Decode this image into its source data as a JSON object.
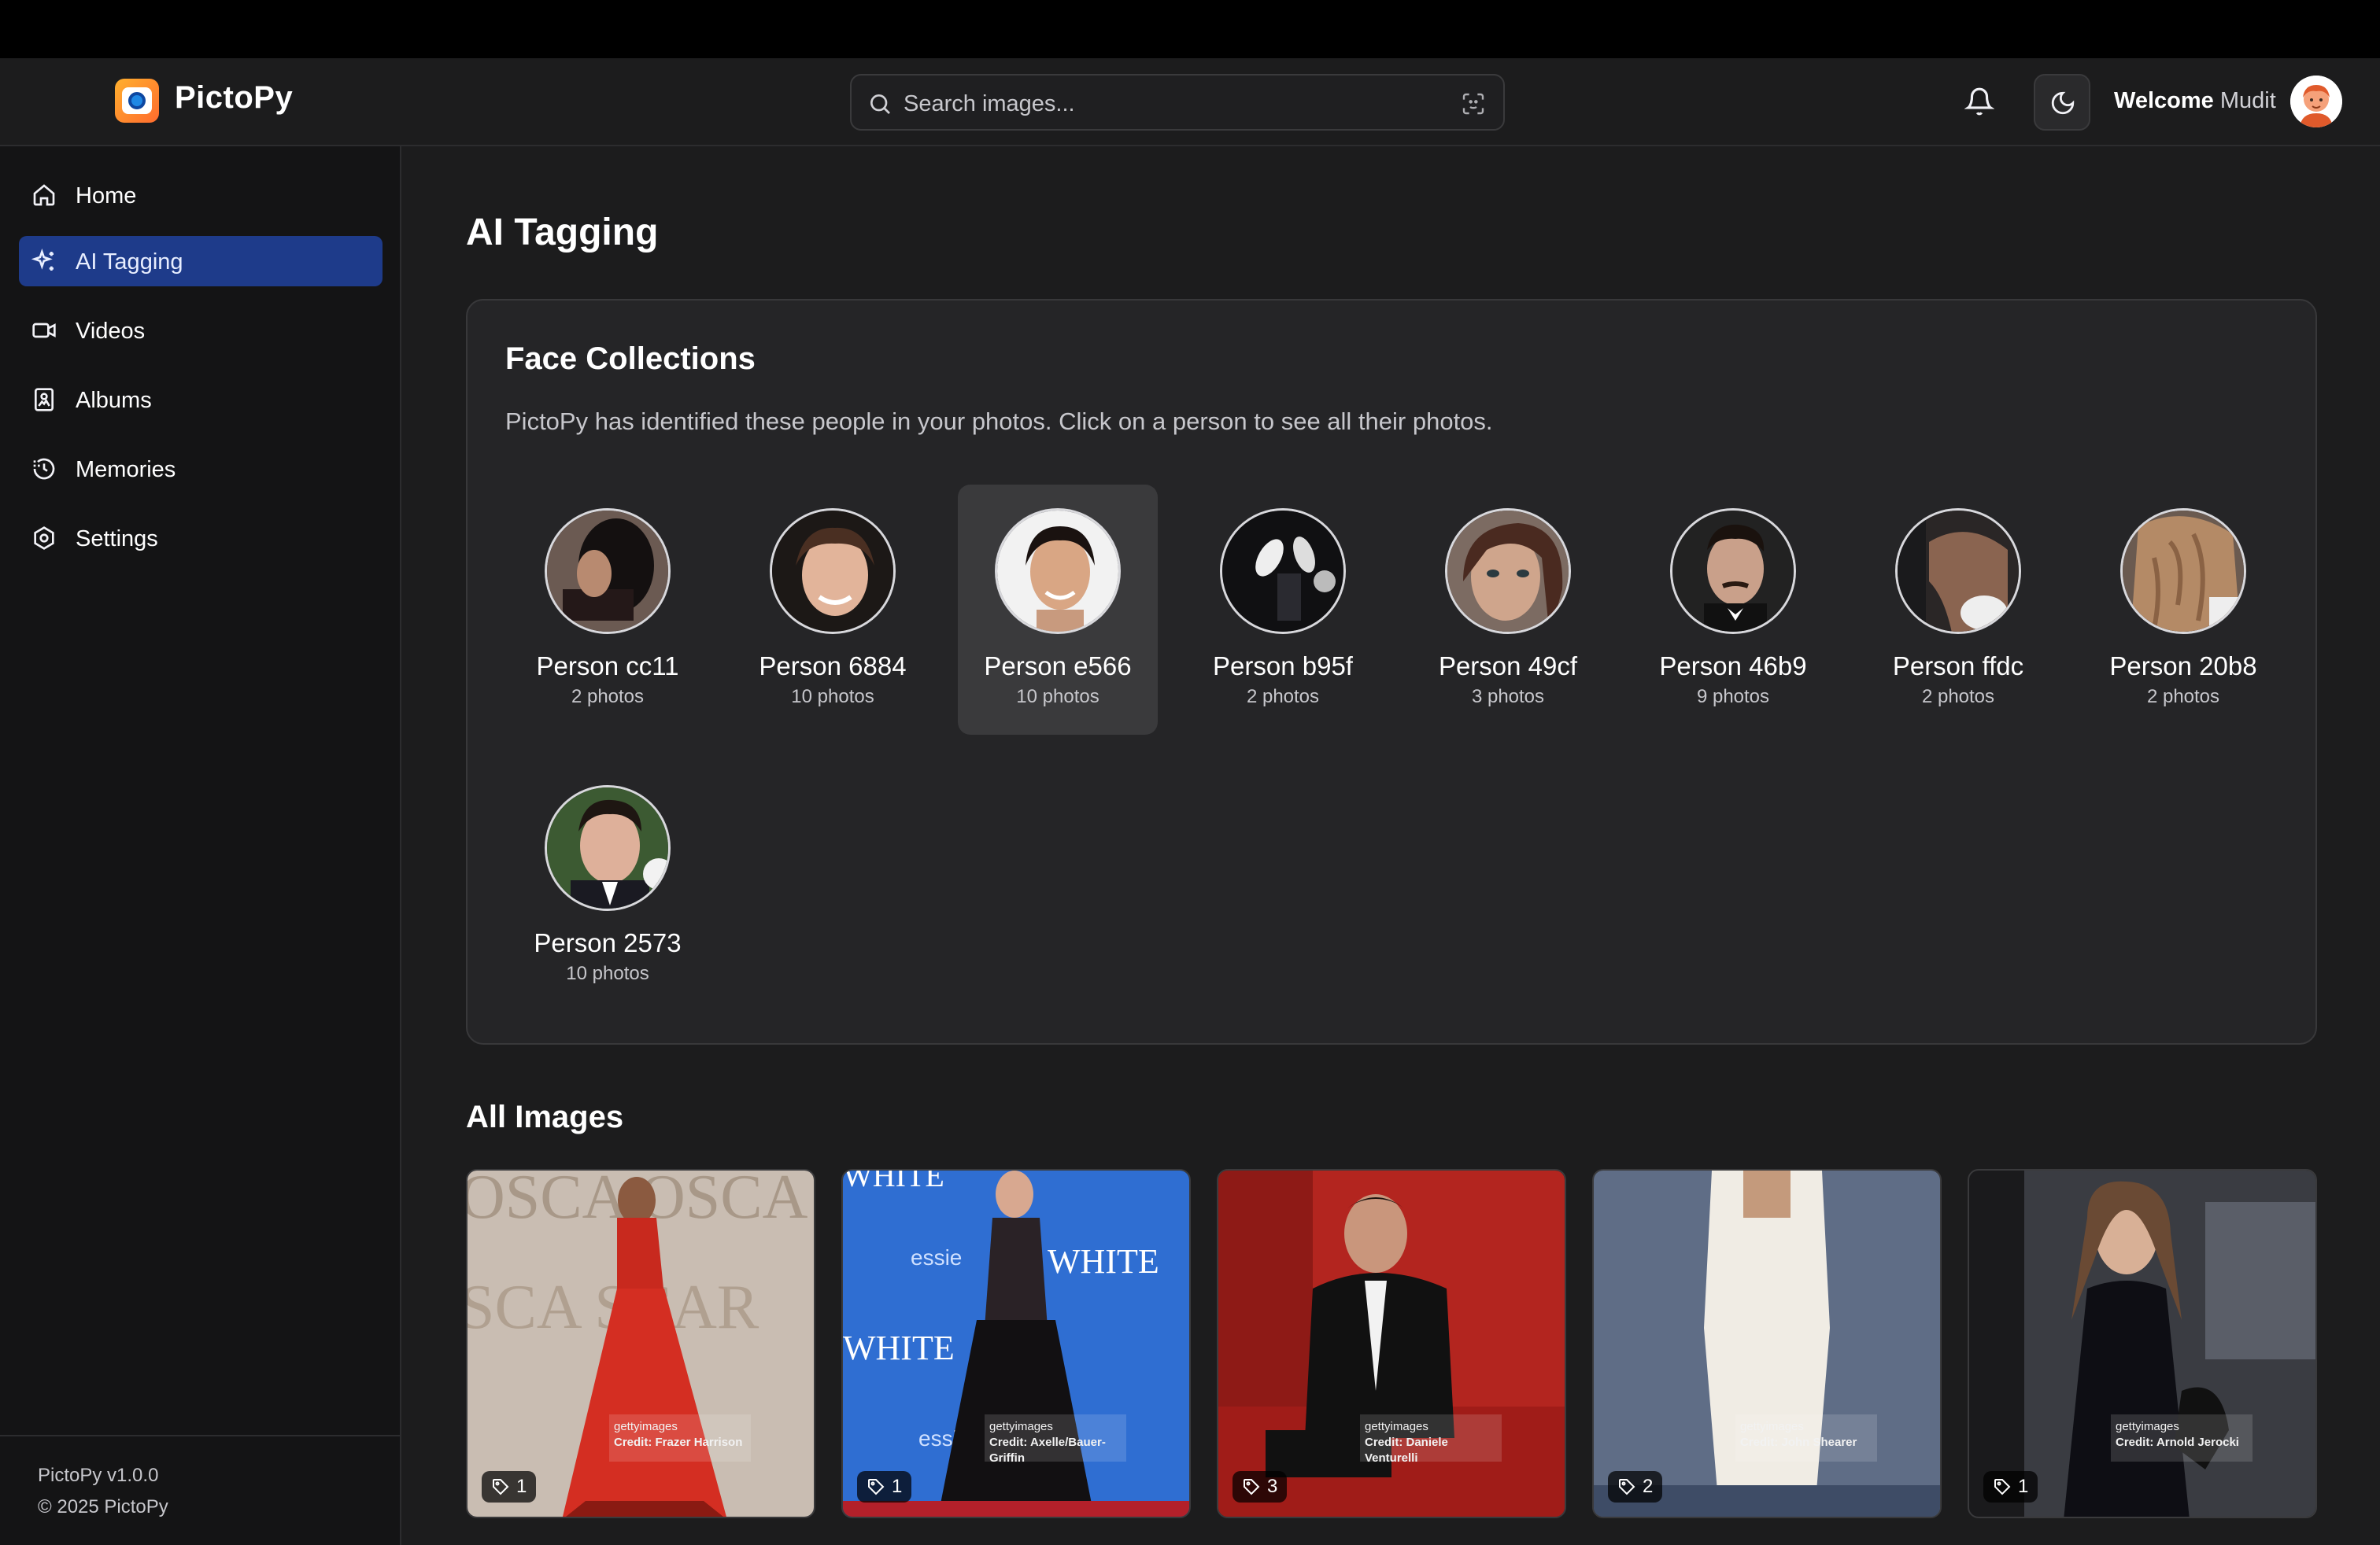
{
  "app": {
    "name": "PictoPy"
  },
  "search": {
    "placeholder": "Search images..."
  },
  "user": {
    "welcome": "Welcome",
    "name": "Mudit"
  },
  "sidebar": {
    "items": [
      {
        "label": "Home",
        "icon": "home-icon",
        "active": false
      },
      {
        "label": "AI Tagging",
        "icon": "sparkles-icon",
        "active": true
      },
      {
        "label": "Videos",
        "icon": "video-icon",
        "active": false
      },
      {
        "label": "Albums",
        "icon": "album-icon",
        "active": false
      },
      {
        "label": "Memories",
        "icon": "history-icon",
        "active": false
      },
      {
        "label": "Settings",
        "icon": "settings-icon",
        "active": false
      }
    ],
    "version": "PictoPy v1.0.0",
    "copyright": "© 2025 PictoPy"
  },
  "page": {
    "title": "AI Tagging"
  },
  "face_collections": {
    "title": "Face Collections",
    "description": "PictoPy has identified these people in your photos. Click on a person to see all their photos.",
    "people": [
      {
        "name": "Person cc11",
        "count": "2 photos",
        "selected": false
      },
      {
        "name": "Person 6884",
        "count": "10 photos",
        "selected": false
      },
      {
        "name": "Person e566",
        "count": "10 photos",
        "selected": true
      },
      {
        "name": "Person b95f",
        "count": "2 photos",
        "selected": false
      },
      {
        "name": "Person 49cf",
        "count": "3 photos",
        "selected": false
      },
      {
        "name": "Person 46b9",
        "count": "9 photos",
        "selected": false
      },
      {
        "name": "Person ffdc",
        "count": "2 photos",
        "selected": false
      },
      {
        "name": "Person 20b8",
        "count": "2 photos",
        "selected": false
      },
      {
        "name": "Person 2573",
        "count": "10 photos",
        "selected": false
      }
    ]
  },
  "all_images": {
    "title": "All Images",
    "images": [
      {
        "tag_count": "1",
        "watermark_brand": "gettyimages",
        "credit": "Credit: Frazer Harrison"
      },
      {
        "tag_count": "1",
        "watermark_brand": "gettyimages",
        "credit": "Credit: Axelle/Bauer-Griffin"
      },
      {
        "tag_count": "3",
        "watermark_brand": "gettyimages",
        "credit": "Credit: Daniele Venturelli"
      },
      {
        "tag_count": "2",
        "watermark_brand": "gettyimages",
        "credit": "Credit: John Shearer"
      },
      {
        "tag_count": "1",
        "watermark_brand": "gettyimages",
        "credit": "Credit: Arnold Jerocki"
      }
    ]
  },
  "colors": {
    "accent": "#1e3b8a",
    "background": "#1c1c1d",
    "card": "#252527"
  }
}
